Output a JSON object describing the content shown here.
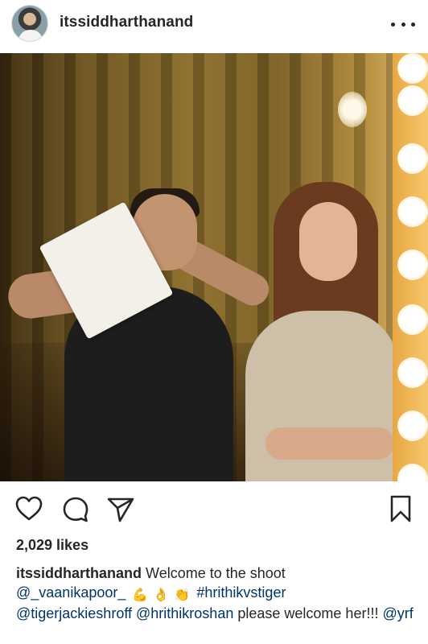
{
  "post": {
    "username": "itssiddharthanand",
    "likes_text": "2,029 likes",
    "caption": {
      "username": "itssiddharthanand",
      "text": "Welcome to the shoot",
      "mention_vaani": "@_vaanikapoor_",
      "hashtag": "#hrithikvstiger",
      "mention_tiger": "@tigerjackieshroff",
      "mention_hrithik": "@hrithikroshan",
      "middle_text": "please welcome her!!!",
      "mention_yrf": "@yrf"
    }
  },
  "icons": {
    "more": "more-options-icon",
    "like": "heart-icon",
    "comment": "comment-icon",
    "share": "paper-plane-icon",
    "save": "bookmark-icon",
    "emoji": [
      "flexed-biceps-emoji",
      "ok-hand-emoji",
      "clapping-hands-emoji"
    ]
  },
  "colors": {
    "text": "#262626",
    "link": "#003569",
    "background": "#ffffff"
  }
}
